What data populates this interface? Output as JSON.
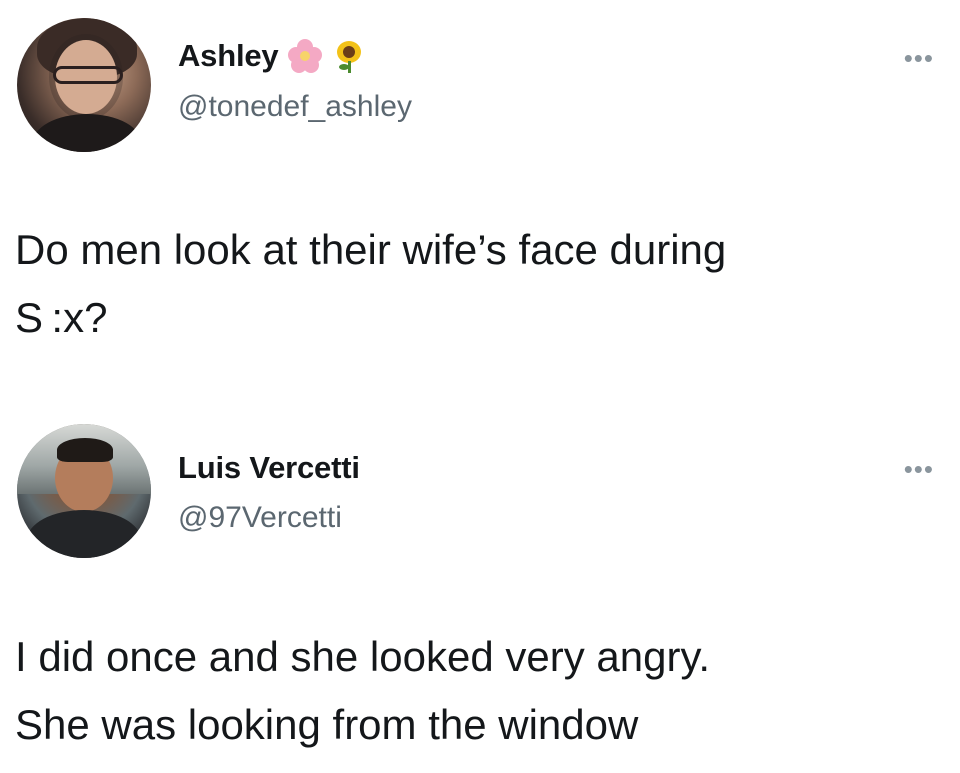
{
  "tweets": [
    {
      "display_name": "Ashley",
      "handle": "@tonedef_ashley",
      "name_emojis": [
        "pink-flower-icon",
        "sunflower-icon"
      ],
      "more_label": "•••",
      "text": "Do men look at their wife’s face during\nS :x?"
    },
    {
      "display_name": "Luis Vercetti",
      "handle": "@97Vercetti",
      "name_emojis": [],
      "more_label": "•••",
      "text": "I did once and she looked very angry.\nShe was looking from the window"
    }
  ]
}
